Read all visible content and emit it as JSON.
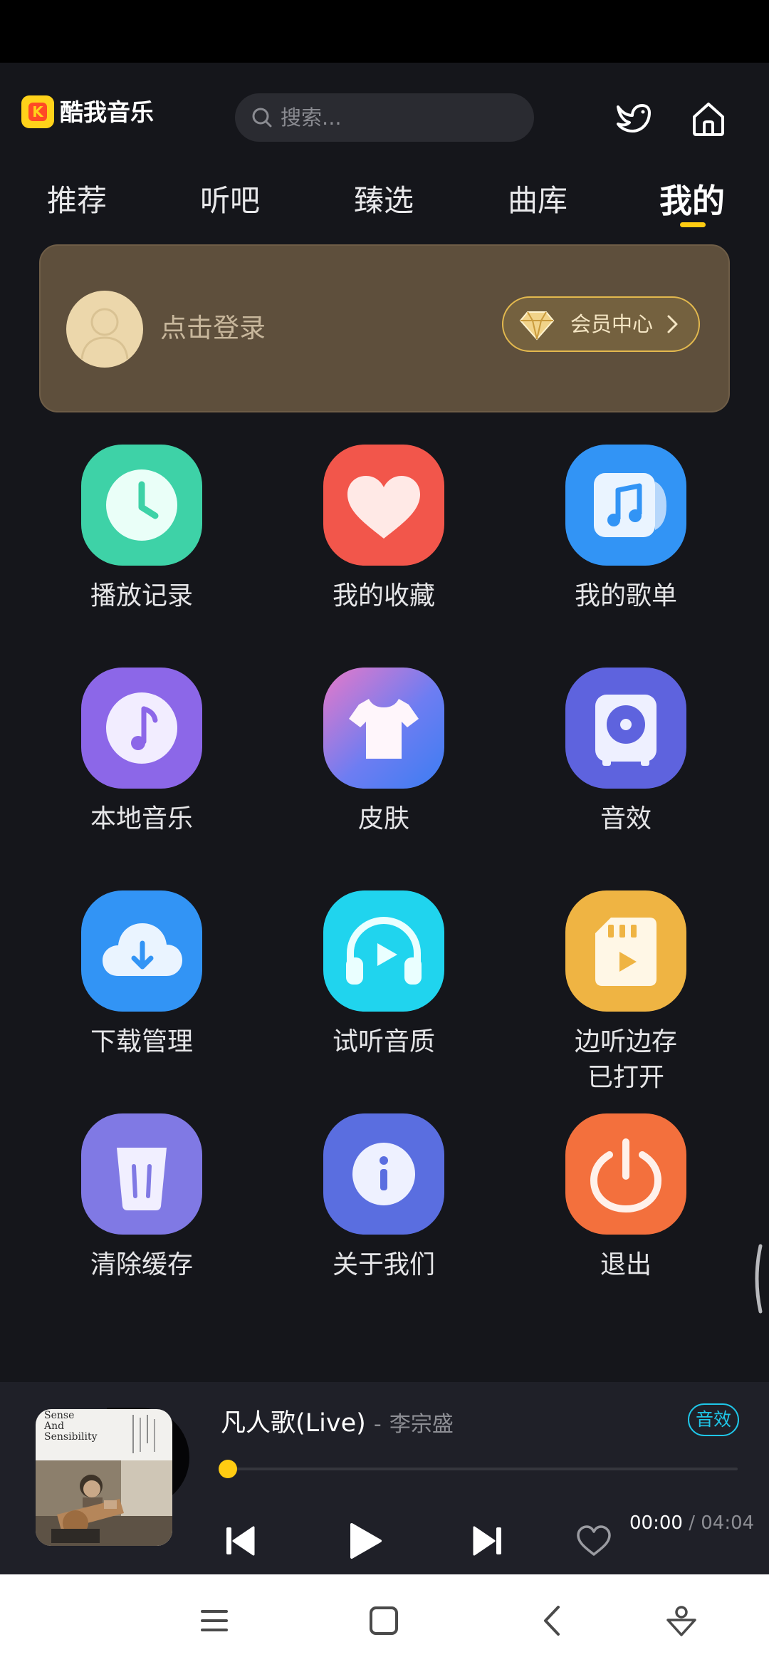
{
  "header": {
    "app_title": "酷我音乐",
    "search": {
      "placeholder": "搜索..."
    }
  },
  "tabs": [
    {
      "label": "推荐",
      "active": false
    },
    {
      "label": "听吧",
      "active": false
    },
    {
      "label": "臻选",
      "active": false
    },
    {
      "label": "曲库",
      "active": false
    },
    {
      "label": "我的",
      "active": true
    }
  ],
  "login_card": {
    "login_text": "点击登录",
    "vip_label": "会员中心"
  },
  "grid": [
    {
      "label": "播放记录",
      "icon": "clock-icon",
      "color": "#3ed2a7"
    },
    {
      "label": "我的收藏",
      "icon": "heart-icon",
      "color": "#f2564b"
    },
    {
      "label": "我的歌单",
      "icon": "music-note-icon",
      "color": "#3294f5"
    },
    {
      "label": "本地音乐",
      "icon": "music-disc-icon",
      "color": "#8c67e8"
    },
    {
      "label": "皮肤",
      "icon": "tshirt-icon",
      "color": "#6d7df2"
    },
    {
      "label": "音效",
      "icon": "speaker-icon",
      "color": "#5e63de"
    },
    {
      "label": "下载管理",
      "icon": "cloud-download-icon",
      "color": "#3294f5"
    },
    {
      "label": "试听音质",
      "icon": "headphones-icon",
      "color": "#20d4ee"
    },
    {
      "label": "边听边存\n已打开",
      "icon": "sd-card-icon",
      "color": "#efb443"
    },
    {
      "label": "清除缓存",
      "icon": "trash-icon",
      "color": "#8079e4"
    },
    {
      "label": "关于我们",
      "icon": "info-icon",
      "color": "#5a6ee0"
    },
    {
      "label": "退出",
      "icon": "power-icon",
      "color": "#f3703d"
    }
  ],
  "player": {
    "song_title": "凡人歌(Live)",
    "separator": "-",
    "artist": "李宗盛",
    "effect_badge": "音效",
    "album_art_text": "Sense\nAnd\nSensibility",
    "progress": 0,
    "current_time": "00:00",
    "time_separator": "/",
    "total_time": "04:04",
    "accent_color": "#ffcc12"
  }
}
